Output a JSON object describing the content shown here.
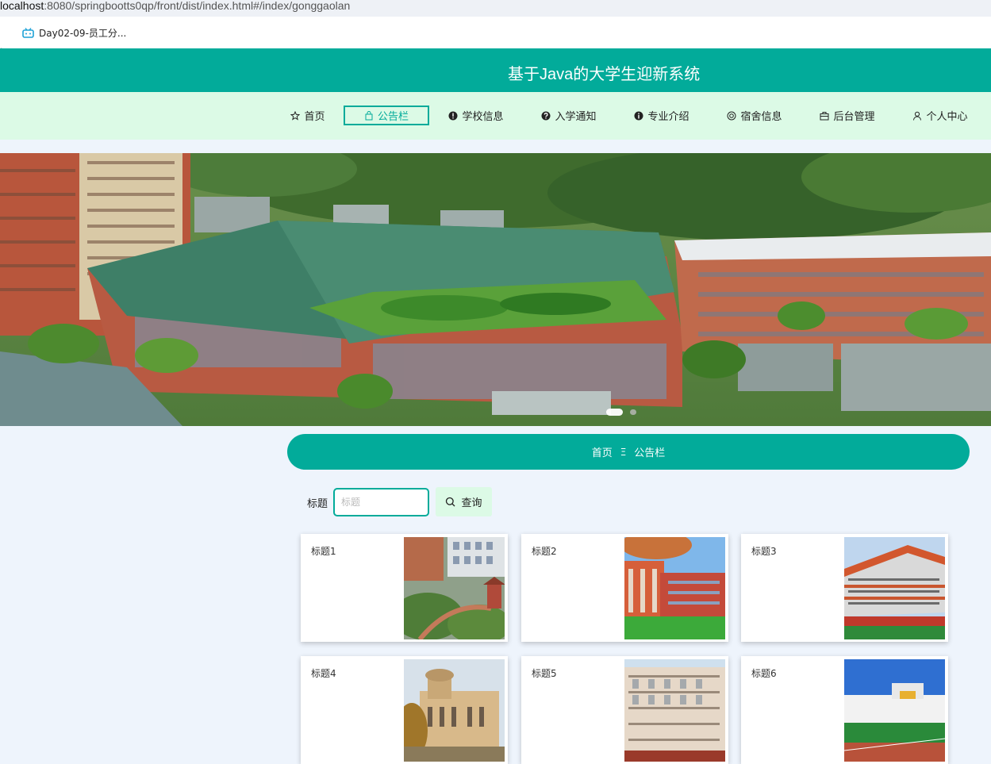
{
  "browser": {
    "url_host": "localhost",
    "url_path": ":8080/springbootts0qp/front/dist/index.html#/index/gonggaolan",
    "bookmark_dot": ".",
    "bookmark_label": "Day02-09-员工分..."
  },
  "header": {
    "title": "基于Java的大学生迎新系统"
  },
  "nav": {
    "items": [
      {
        "label": "首页",
        "icon": "star-icon"
      },
      {
        "label": "公告栏",
        "icon": "bag-icon",
        "active": true
      },
      {
        "label": "学校信息",
        "icon": "info-icon"
      },
      {
        "label": "入学通知",
        "icon": "question-icon"
      },
      {
        "label": "专业介绍",
        "icon": "info-icon"
      },
      {
        "label": "宿舍信息",
        "icon": "camera-icon"
      },
      {
        "label": "后台管理",
        "icon": "briefcase-icon"
      },
      {
        "label": "个人中心",
        "icon": "user-icon"
      }
    ]
  },
  "breadcrumb": {
    "home": "首页",
    "separator": "Ξ",
    "current": "公告栏"
  },
  "search": {
    "label": "标题",
    "placeholder": "标题",
    "value": "",
    "button_label": "查询"
  },
  "cards": [
    {
      "title": "标题1"
    },
    {
      "title": "标题2"
    },
    {
      "title": "标题3"
    },
    {
      "title": "标题4"
    },
    {
      "title": "标题5"
    },
    {
      "title": "标题6"
    }
  ],
  "colors": {
    "primary": "#02ab9a",
    "nav_bg": "#dcfae6",
    "page_bg": "#eef4fc"
  }
}
